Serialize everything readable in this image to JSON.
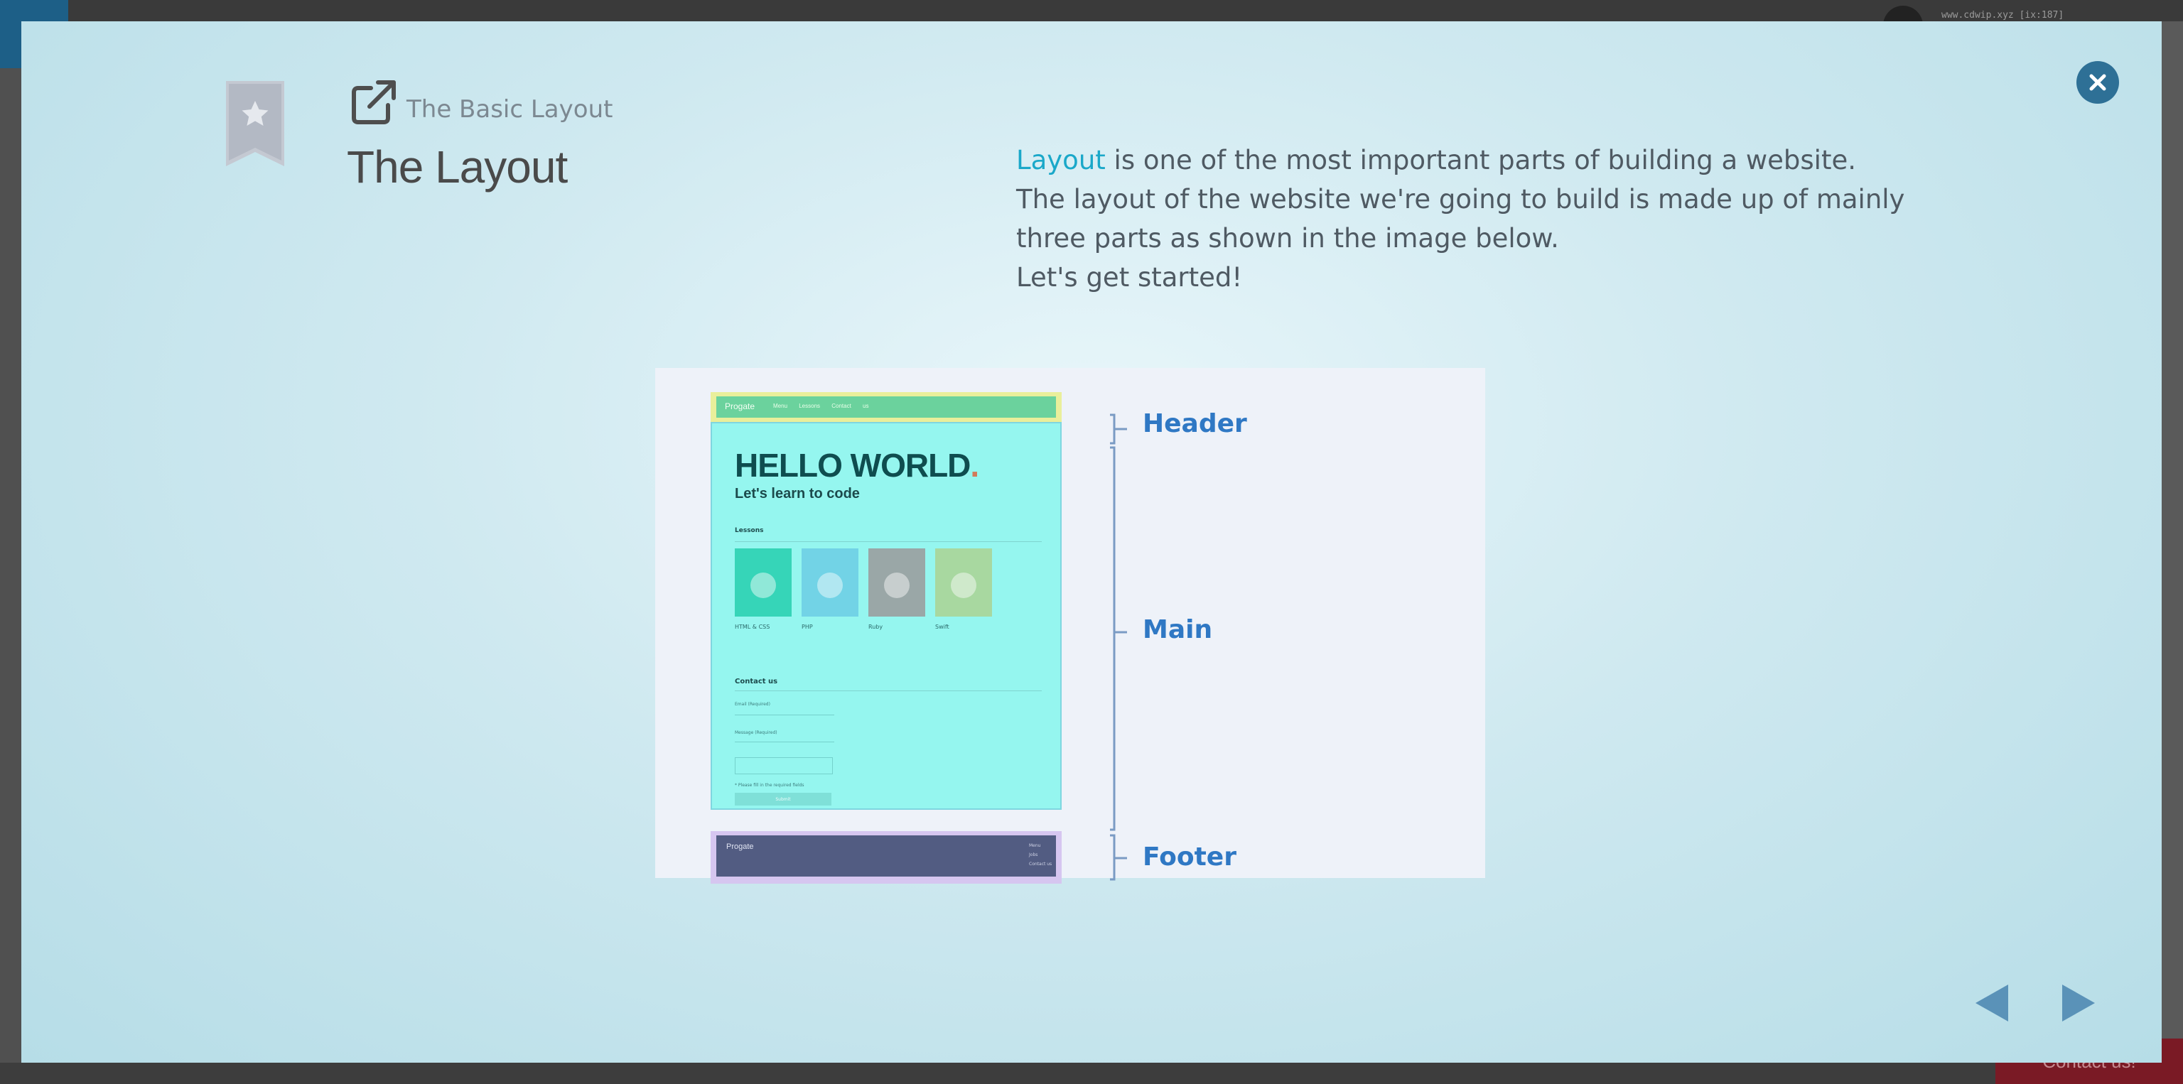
{
  "background": {
    "url_text": "www.cdwip.xyz [ix:187]",
    "contact_label": "Contact us!"
  },
  "modal": {
    "breadcrumb": "The Basic Layout",
    "title": "The Layout",
    "description": {
      "highlight": "Layout",
      "line1_rest": " is one of the most important parts of building a website.",
      "line2": "The layout of the website we're going to build is made up of mainly",
      "line3": "three parts as shown in the image below.",
      "line4": "Let's get started!"
    },
    "colors": {
      "accent": "#1aa8c9",
      "close_button": "#2e7096",
      "nav_arrow": "#5a92b8",
      "bracket_label": "#2f78c4"
    },
    "icons": {
      "bookmark": "star-bookmark-icon",
      "external": "external-link-icon",
      "close": "close-icon",
      "prev": "triangle-left-icon",
      "next": "triangle-right-icon"
    }
  },
  "illustration": {
    "header_brand": "Progate",
    "header_nav": "Menu Lessons Contact us",
    "hello": "HELLO WORLD",
    "hello_dot": ".",
    "subtitle": "Let's learn to code",
    "lessons_heading": "Lessons",
    "cards": [
      {
        "label": "HTML & CSS",
        "color": "#36d5b8"
      },
      {
        "label": "PHP",
        "color": "#72d3e6"
      },
      {
        "label": "Ruby",
        "color": "#9aa7a7"
      },
      {
        "label": "Swift",
        "color": "#a8d8a0"
      }
    ],
    "contact_heading": "Contact us",
    "email_label": "Email (Required)",
    "message_label": "Message (Required)",
    "note": "* Please fill in the required fields",
    "submit_label": "Submit",
    "footer_brand": "Progate",
    "footer_links": [
      "Menu",
      "Jobs",
      "Contact us"
    ],
    "labels": {
      "header": "Header",
      "main": "Main",
      "footer": "Footer"
    }
  }
}
